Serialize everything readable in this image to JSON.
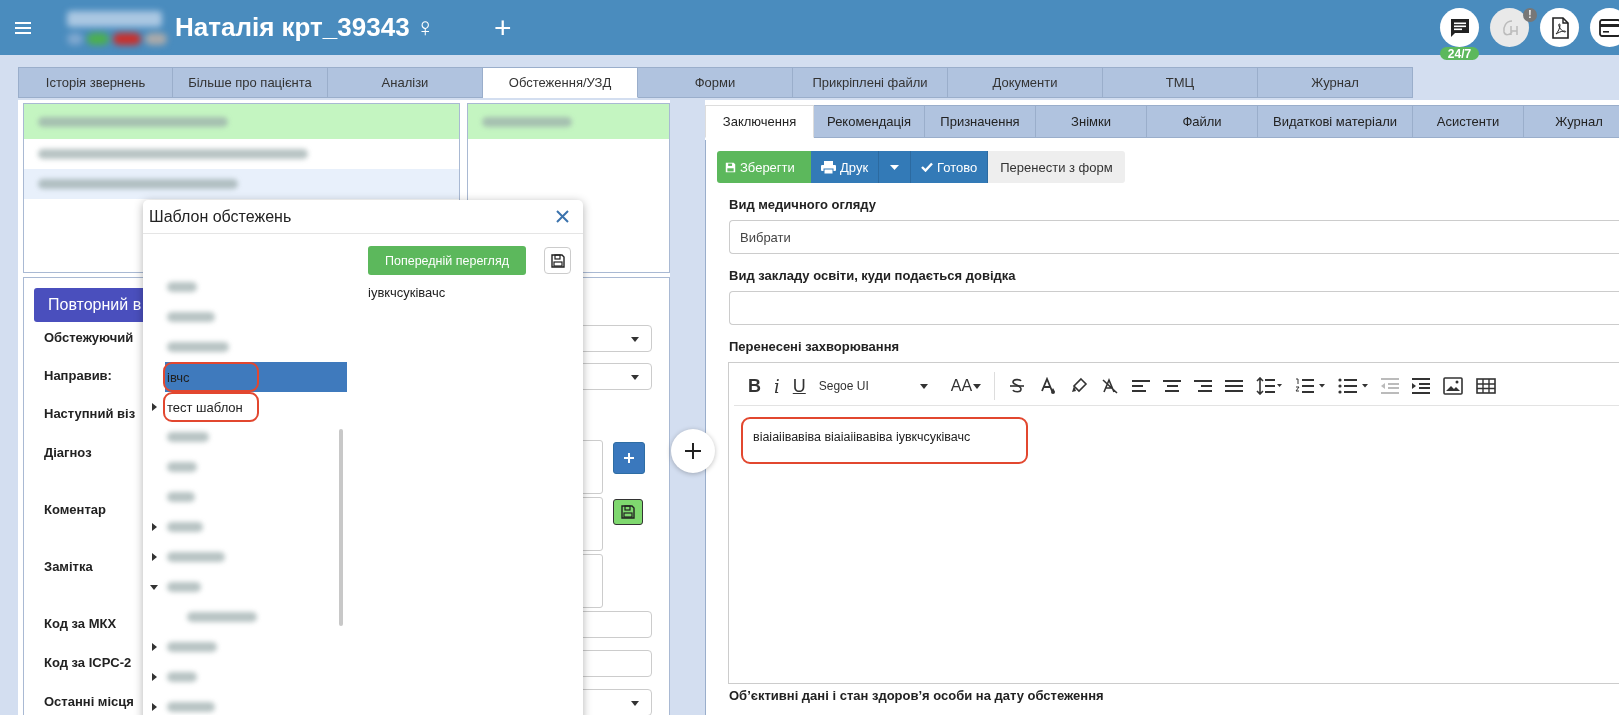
{
  "header": {
    "patient_name": "Наталія крт_39343",
    "gender_symbol": "♀",
    "add_symbol": "+",
    "support_badge": "24/7",
    "alert_badge": "!"
  },
  "main_tabs": [
    {
      "label": "Історія звернень",
      "selected": false
    },
    {
      "label": "Більше про пацієнта",
      "selected": false
    },
    {
      "label": "Аналізи",
      "selected": false
    },
    {
      "label": "Обстеження/УЗД",
      "selected": true
    },
    {
      "label": "Форми",
      "selected": false
    },
    {
      "label": "Прикріплені файли",
      "selected": false
    },
    {
      "label": "Документи",
      "selected": false
    },
    {
      "label": "ТМЦ",
      "selected": false
    },
    {
      "label": "Журнал",
      "selected": false
    }
  ],
  "visit_list": [
    {
      "selected": true,
      "hovered": false
    },
    {
      "selected": false,
      "hovered": false
    },
    {
      "selected": false,
      "hovered": true
    }
  ],
  "form": {
    "repeat_button": "Повторний в",
    "rows": [
      {
        "kind": "select",
        "label": "Обстежуючий"
      },
      {
        "kind": "select",
        "label": "Направив:"
      },
      {
        "kind": "hidden",
        "label": "Наступний віз"
      },
      {
        "kind": "textarea_add",
        "label": "Діагноз"
      },
      {
        "kind": "textarea_save",
        "label": "Коментар"
      },
      {
        "kind": "textarea",
        "label": "Замітка"
      },
      {
        "kind": "input",
        "label": "Код за МКХ"
      },
      {
        "kind": "input",
        "label": "Код за ICPC-2"
      },
      {
        "kind": "select",
        "label": "Останні місця"
      }
    ]
  },
  "template_dialog": {
    "title": "Шаблон обстежень",
    "preview_button": "Попередній перегляд",
    "preview_text": "іувкчсуківачс",
    "tree": [
      {
        "kind": "blurred",
        "selected": false
      },
      {
        "kind": "blurred",
        "selected": false
      },
      {
        "kind": "blurred",
        "selected": false
      },
      {
        "kind": "text",
        "label": "івчс",
        "selected": true,
        "annotated": true
      },
      {
        "kind": "text",
        "label": "тест шаблон",
        "selected": false,
        "expanded": false,
        "annotated": true
      },
      {
        "kind": "blurred",
        "selected": false
      },
      {
        "kind": "blurred",
        "selected": false
      },
      {
        "kind": "blurred",
        "selected": false
      },
      {
        "kind": "blurred",
        "selected": false,
        "expanded": false
      },
      {
        "kind": "blurred",
        "selected": false,
        "expanded": false
      },
      {
        "kind": "blurred",
        "selected": false,
        "expanded": true,
        "children": [
          {
            "kind": "blurred",
            "selected": false
          }
        ]
      },
      {
        "kind": "blurred",
        "selected": false,
        "expanded": false
      },
      {
        "kind": "blurred",
        "selected": false,
        "expanded": false
      },
      {
        "kind": "blurred",
        "selected": false,
        "expanded": false
      }
    ]
  },
  "sub_tabs": [
    {
      "label": "Заключення",
      "selected": true
    },
    {
      "label": "Рекомендація",
      "selected": false
    },
    {
      "label": "Призначення",
      "selected": false
    },
    {
      "label": "Знімки",
      "selected": false
    },
    {
      "label": "Файли",
      "selected": false
    },
    {
      "label": "Видаткові матеріали",
      "selected": false
    },
    {
      "label": "Асистенти",
      "selected": false
    },
    {
      "label": "Журнал",
      "selected": false
    }
  ],
  "toolbar": {
    "save": "Зберегти",
    "print": "Друк",
    "done": "Готово",
    "transfer": "Перенести з форм"
  },
  "fields": [
    {
      "kind": "select",
      "label": "Вид медичного огляду",
      "value": "Вибрати"
    },
    {
      "kind": "input",
      "label": "Вид закладу освіти, куди подається довідка"
    },
    {
      "kind": "editor",
      "label": "Перенесені захворювання",
      "font": "Segoe UI",
      "letters": [
        "B",
        "i",
        "U"
      ],
      "size_glyph": "AA",
      "content": "віаіаіівавіва віаіаіівавіва іувкчсуківачс",
      "annotated": true
    },
    {
      "kind": "heading",
      "label": "Об’єктивні дані і стан здоров’я особи на дату обстеження"
    }
  ]
}
